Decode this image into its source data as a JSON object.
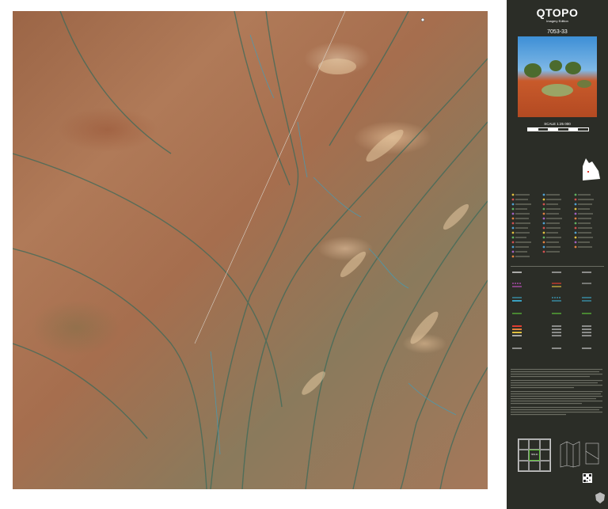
{
  "panel": {
    "title": "QTOPO",
    "subtitle": "Imagery Edition",
    "sheet_number": "7053-33",
    "scale": "SCALE 1:25 000"
  },
  "index_map": {
    "cells": [
      "",
      "",
      "",
      "",
      "7053-33",
      "",
      "",
      "",
      ""
    ]
  },
  "colors": {
    "panel_bg": "#2b2d27",
    "water": "#3aa0c0",
    "highlight": "#5ec23a"
  }
}
